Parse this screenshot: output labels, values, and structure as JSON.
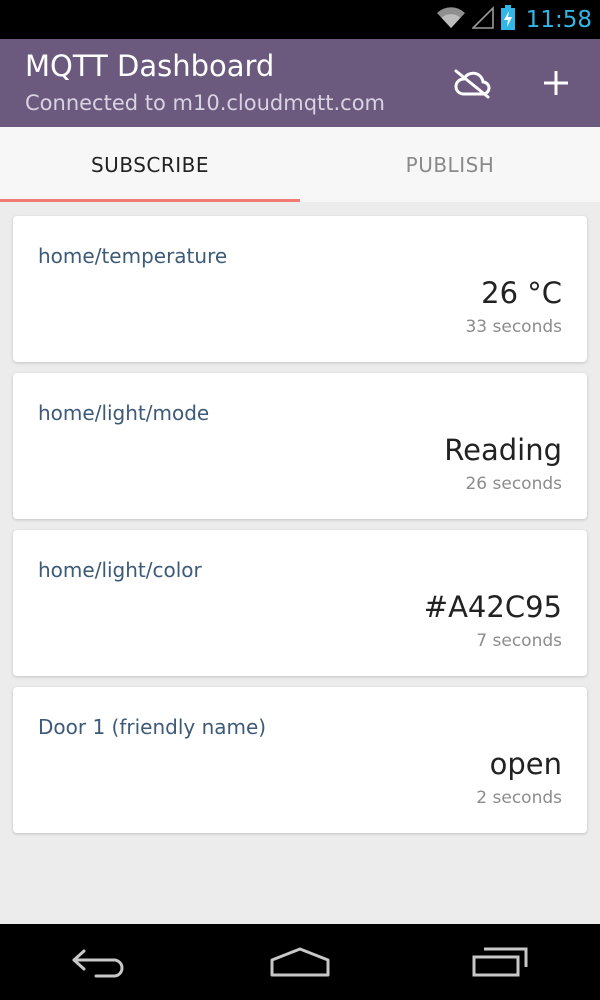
{
  "status_bar": {
    "time": "11:58",
    "icons": [
      "wifi-icon",
      "signal-icon",
      "battery-charging-icon"
    ],
    "time_color": "#33b5e5"
  },
  "app_bar": {
    "title": "MQTT Dashboard",
    "subtitle": "Connected to m10.cloudmqtt.com",
    "background_color": "#6c5a7e",
    "actions": [
      {
        "icon": "cloud-off-icon"
      },
      {
        "icon": "plus-icon"
      }
    ]
  },
  "tabs": [
    {
      "label": "SUBSCRIBE",
      "active": true
    },
    {
      "label": "PUBLISH",
      "active": false
    }
  ],
  "accent_color": "#f07a74",
  "subscriptions": [
    {
      "topic": "home/temperature",
      "value": "26 °C",
      "age": "33 seconds"
    },
    {
      "topic": "home/light/mode",
      "value": "Reading",
      "age": "26 seconds"
    },
    {
      "topic": "home/light/color",
      "value": "#A42C95",
      "age": "7 seconds"
    },
    {
      "topic": "Door 1 (friendly name)",
      "value": "open",
      "age": "2 seconds"
    }
  ],
  "nav_bar": {
    "buttons": [
      "back-icon",
      "home-icon",
      "recent-apps-icon"
    ]
  }
}
